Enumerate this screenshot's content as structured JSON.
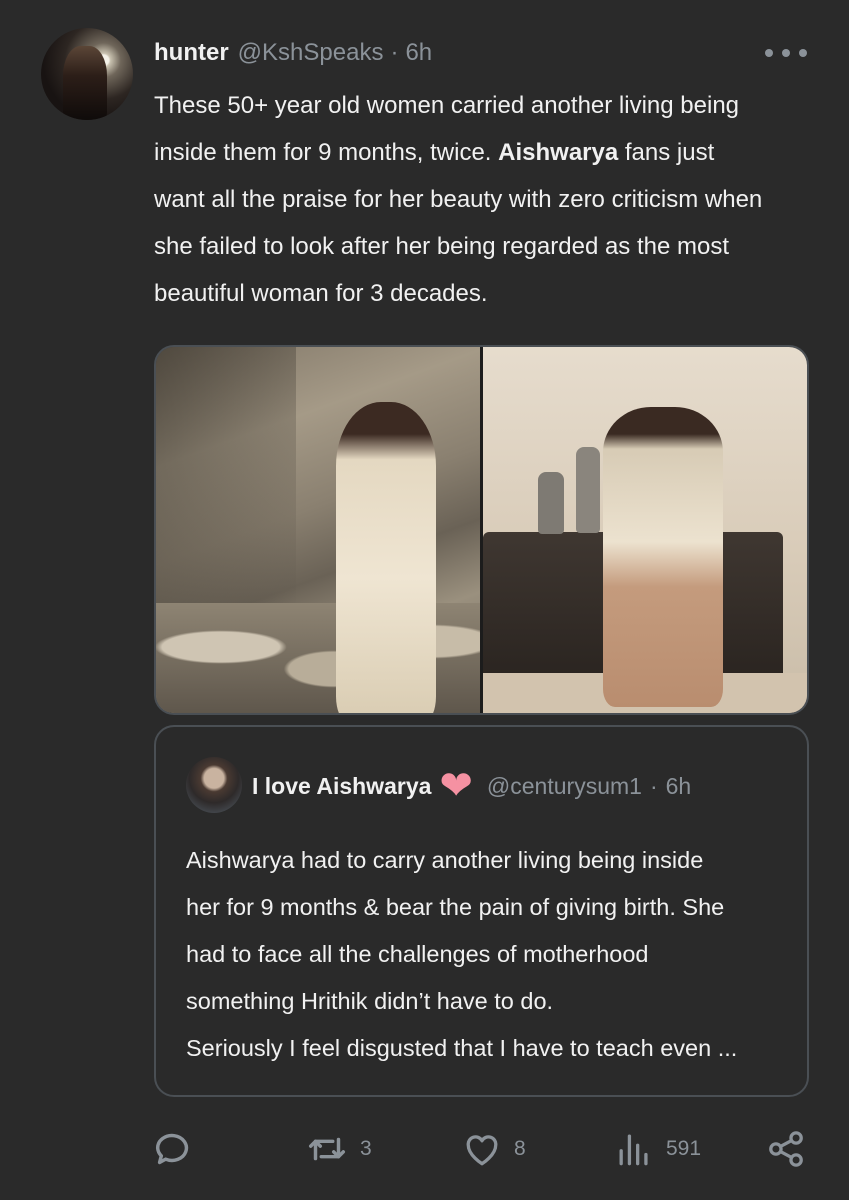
{
  "tweet": {
    "author_name": "hunter",
    "author_handle": "@KshSpeaks",
    "separator": "·",
    "time": "6h",
    "text_line1": "These 50+ year old women carried another living being",
    "text_line2_pre": "inside them for 9 months, twice. ",
    "text_bold": "Aishwarya",
    "text_line2_post": " fans just",
    "text_line3": "want all the praise for her beauty with zero criticism when",
    "text_line4": "she failed to look after her being regarded as the most",
    "text_line5": "beautiful woman for 3 decades."
  },
  "quoted": {
    "author_name": "I love Aishwarya",
    "heart_emoji": "❤",
    "author_handle": "@centurysum1",
    "separator": "·",
    "time": "6h",
    "line1": "Aishwarya had to carry another living being inside",
    "line2": "her for 9 months & bear the pain of giving birth. She",
    "line3": "had to face all the challenges of motherhood",
    "line4": "something Hrithik didn’t have to do.",
    "line5": "Seriously I feel disgusted that I have to teach even ..."
  },
  "actions": {
    "reply_count": "",
    "retweet_count": "3",
    "like_count": "8",
    "view_count": "591"
  },
  "icons": {
    "reply": "reply-icon",
    "retweet": "retweet-icon",
    "like": "heart-icon",
    "views": "views-icon",
    "share": "share-icon",
    "more": "more-icon"
  },
  "colors": {
    "background": "#2a2a2a",
    "text": "#f1f1f1",
    "muted": "#8b9299",
    "border": "#4a4f54",
    "heart_emoji": "#f591a2"
  }
}
